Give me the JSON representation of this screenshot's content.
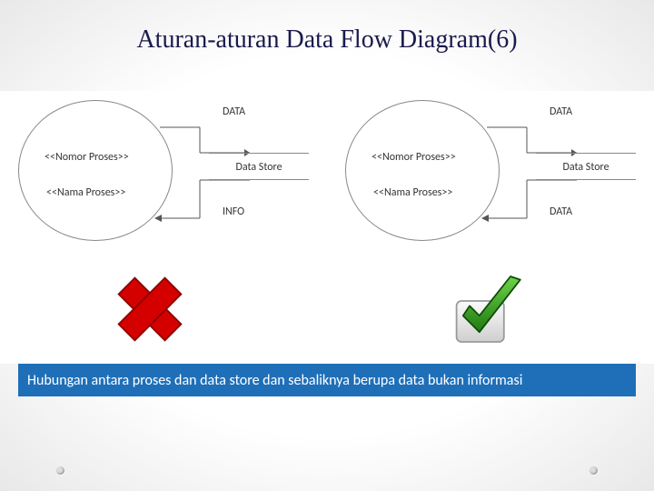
{
  "title": "Aturan-aturan Data Flow Diagram(6)",
  "left": {
    "process_num": "<<Nomor Proses>>",
    "process_name": "<<Nama Proses>>",
    "flow_in": "DATA",
    "flow_out": "INFO",
    "store": "Data Store"
  },
  "right": {
    "process_num": "<<Nomor Proses>>",
    "process_name": "<<Nama Proses>>",
    "flow_in": "DATA",
    "flow_out": "DATA",
    "store": "Data Store"
  },
  "caption": "Hubungan antara proses dan data store dan sebaliknya berupa data bukan informasi"
}
